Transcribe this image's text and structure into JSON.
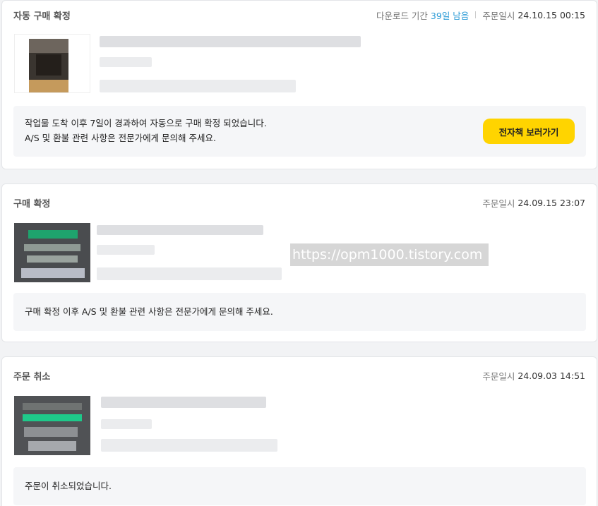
{
  "orders": [
    {
      "status": "자동 구매 확정",
      "download_label": "다운로드 기간",
      "download_remaining": "39일 남음",
      "order_date_label": "주문일시",
      "order_date": "24.10.15 00:15",
      "notice_lines": [
        "작업물 도착 이후 7일이 경과하여 자동으로 구매 확정 되었습니다.",
        "A/S 및 환불 관련 사항은 전문가에게 문의해 주세요."
      ],
      "button_label": "전자책 보러가기"
    },
    {
      "status": "구매 확정",
      "order_date_label": "주문일시",
      "order_date": "24.09.15 23:07",
      "notice_lines": [
        "구매 확정 이후 A/S 및 환불 관련 사항은 전문가에게 문의해 주세요."
      ]
    },
    {
      "status": "주문 취소",
      "order_date_label": "주문일시",
      "order_date": "24.09.03 14:51",
      "notice_lines": [
        "주문이 취소되었습니다."
      ]
    }
  ],
  "watermark": "https://opm1000.tistory.com",
  "colors": {
    "accent_button": "#ffd400",
    "highlight_text": "#2b9bd6"
  }
}
